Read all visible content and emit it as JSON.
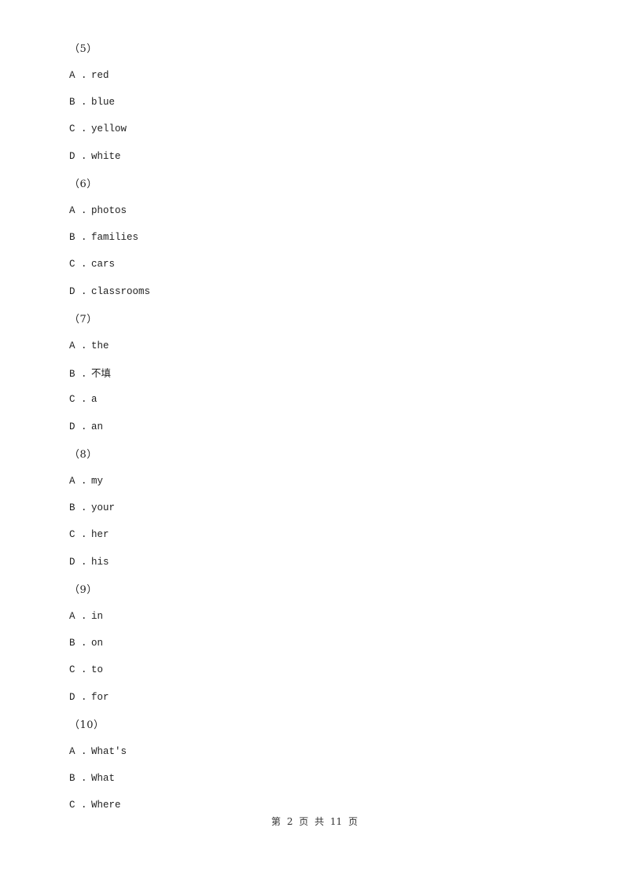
{
  "questions": [
    {
      "label": "（5）",
      "options": [
        {
          "letter": "A .",
          "text": "red"
        },
        {
          "letter": "B .",
          "text": "blue"
        },
        {
          "letter": "C .",
          "text": "yellow"
        },
        {
          "letter": "D .",
          "text": "white"
        }
      ]
    },
    {
      "label": "（6）",
      "options": [
        {
          "letter": "A .",
          "text": "photos"
        },
        {
          "letter": "B .",
          "text": "families"
        },
        {
          "letter": "C .",
          "text": "cars"
        },
        {
          "letter": "D .",
          "text": "classrooms"
        }
      ]
    },
    {
      "label": "（7）",
      "options": [
        {
          "letter": "A .",
          "text": "the"
        },
        {
          "letter": "B .",
          "text": "不填"
        },
        {
          "letter": "C .",
          "text": "a"
        },
        {
          "letter": "D .",
          "text": "an"
        }
      ]
    },
    {
      "label": "（8）",
      "options": [
        {
          "letter": "A .",
          "text": "my"
        },
        {
          "letter": "B .",
          "text": "your"
        },
        {
          "letter": "C .",
          "text": "her"
        },
        {
          "letter": "D .",
          "text": "his"
        }
      ]
    },
    {
      "label": "（9）",
      "options": [
        {
          "letter": "A .",
          "text": "in"
        },
        {
          "letter": "B .",
          "text": "on"
        },
        {
          "letter": "C .",
          "text": "to"
        },
        {
          "letter": "D .",
          "text": "for"
        }
      ]
    },
    {
      "label": "（10）",
      "options": [
        {
          "letter": "A .",
          "text": "What's"
        },
        {
          "letter": "B .",
          "text": "What"
        },
        {
          "letter": "C .",
          "text": "Where"
        }
      ]
    }
  ],
  "footer": {
    "text": "第 2 页 共 11 页"
  }
}
